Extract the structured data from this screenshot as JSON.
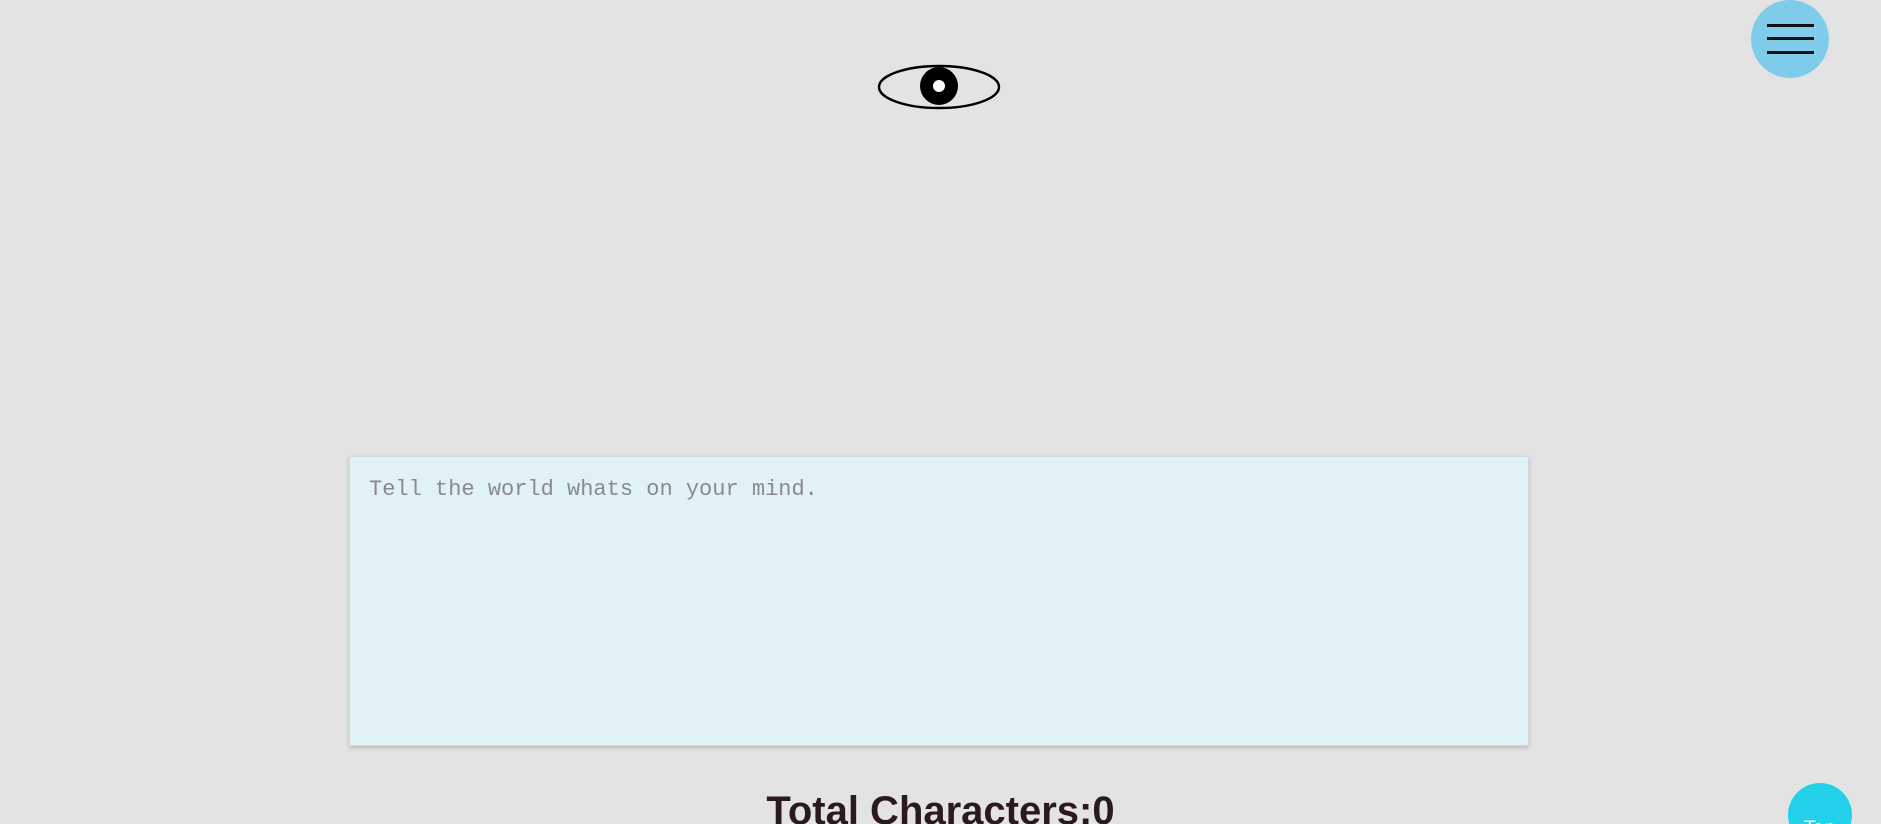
{
  "header": {
    "logo_icon": "eye-icon",
    "menu_icon": "hamburger-menu-icon",
    "menu_color": "#7ecbea"
  },
  "composer": {
    "placeholder": "Tell the world whats on your mind.",
    "value": "",
    "background_color": "#e0f2f5"
  },
  "counter": {
    "label": "Total Characters:",
    "count": "0"
  },
  "footer": {
    "top_button_label": "Top",
    "top_button_color": "#22d0ea"
  }
}
